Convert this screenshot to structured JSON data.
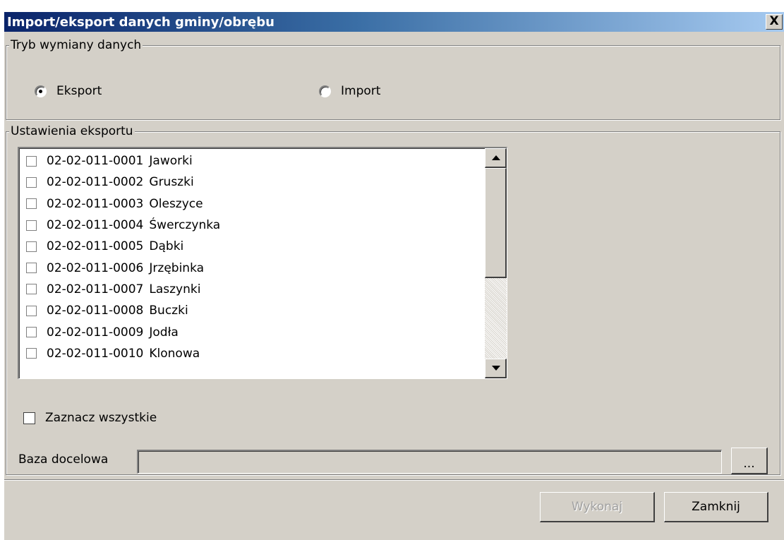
{
  "window": {
    "title": "Import/eksport danych gminy/obrębu",
    "close_label": "X"
  },
  "mode_group": {
    "legend": "Tryb wymiany danych",
    "options": [
      {
        "label": "Eksport",
        "checked": true
      },
      {
        "label": "Import",
        "checked": false
      }
    ]
  },
  "export_group": {
    "legend": "Ustawienia eksportu",
    "items": [
      {
        "code": "02-02-011-0001",
        "name": "Jaworki",
        "checked": false
      },
      {
        "code": "02-02-011-0002",
        "name": "Gruszki",
        "checked": false
      },
      {
        "code": "02-02-011-0003",
        "name": "Oleszyce",
        "checked": false
      },
      {
        "code": "02-02-011-0004",
        "name": "Śwerczynka",
        "checked": false
      },
      {
        "code": "02-02-011-0005",
        "name": "Dąbki",
        "checked": false
      },
      {
        "code": "02-02-011-0006",
        "name": "Jrzębinka",
        "checked": false
      },
      {
        "code": "02-02-011-0007",
        "name": "Laszynki",
        "checked": false
      },
      {
        "code": "02-02-011-0008",
        "name": "Buczki",
        "checked": false
      },
      {
        "code": "02-02-011-0009",
        "name": "Jodła",
        "checked": false
      },
      {
        "code": "02-02-011-0010",
        "name": "Klonowa",
        "checked": false
      }
    ],
    "select_all_label": "Zaznacz wszystkie",
    "target_db_label": "Baza docelowa",
    "target_db_value": "",
    "browse_label": "..."
  },
  "footer": {
    "execute_label": "Wykonaj",
    "close_label": "Zamknij"
  }
}
